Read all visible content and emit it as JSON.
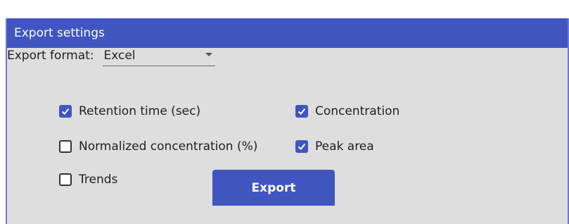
{
  "panel": {
    "title": "Export settings"
  },
  "export_format": {
    "label": "Export format:",
    "selected": "Excel"
  },
  "options": [
    {
      "label": "Retention time (sec)",
      "checked": true
    },
    {
      "label": "Concentration",
      "checked": true
    },
    {
      "label": "Normalized concentration (%)",
      "checked": false
    },
    {
      "label": "Peak area",
      "checked": true
    },
    {
      "label": "Trends",
      "checked": false
    }
  ],
  "export_button": {
    "label": "Export"
  },
  "colors": {
    "accent": "#4155c0",
    "panel_background": "#dedede"
  }
}
